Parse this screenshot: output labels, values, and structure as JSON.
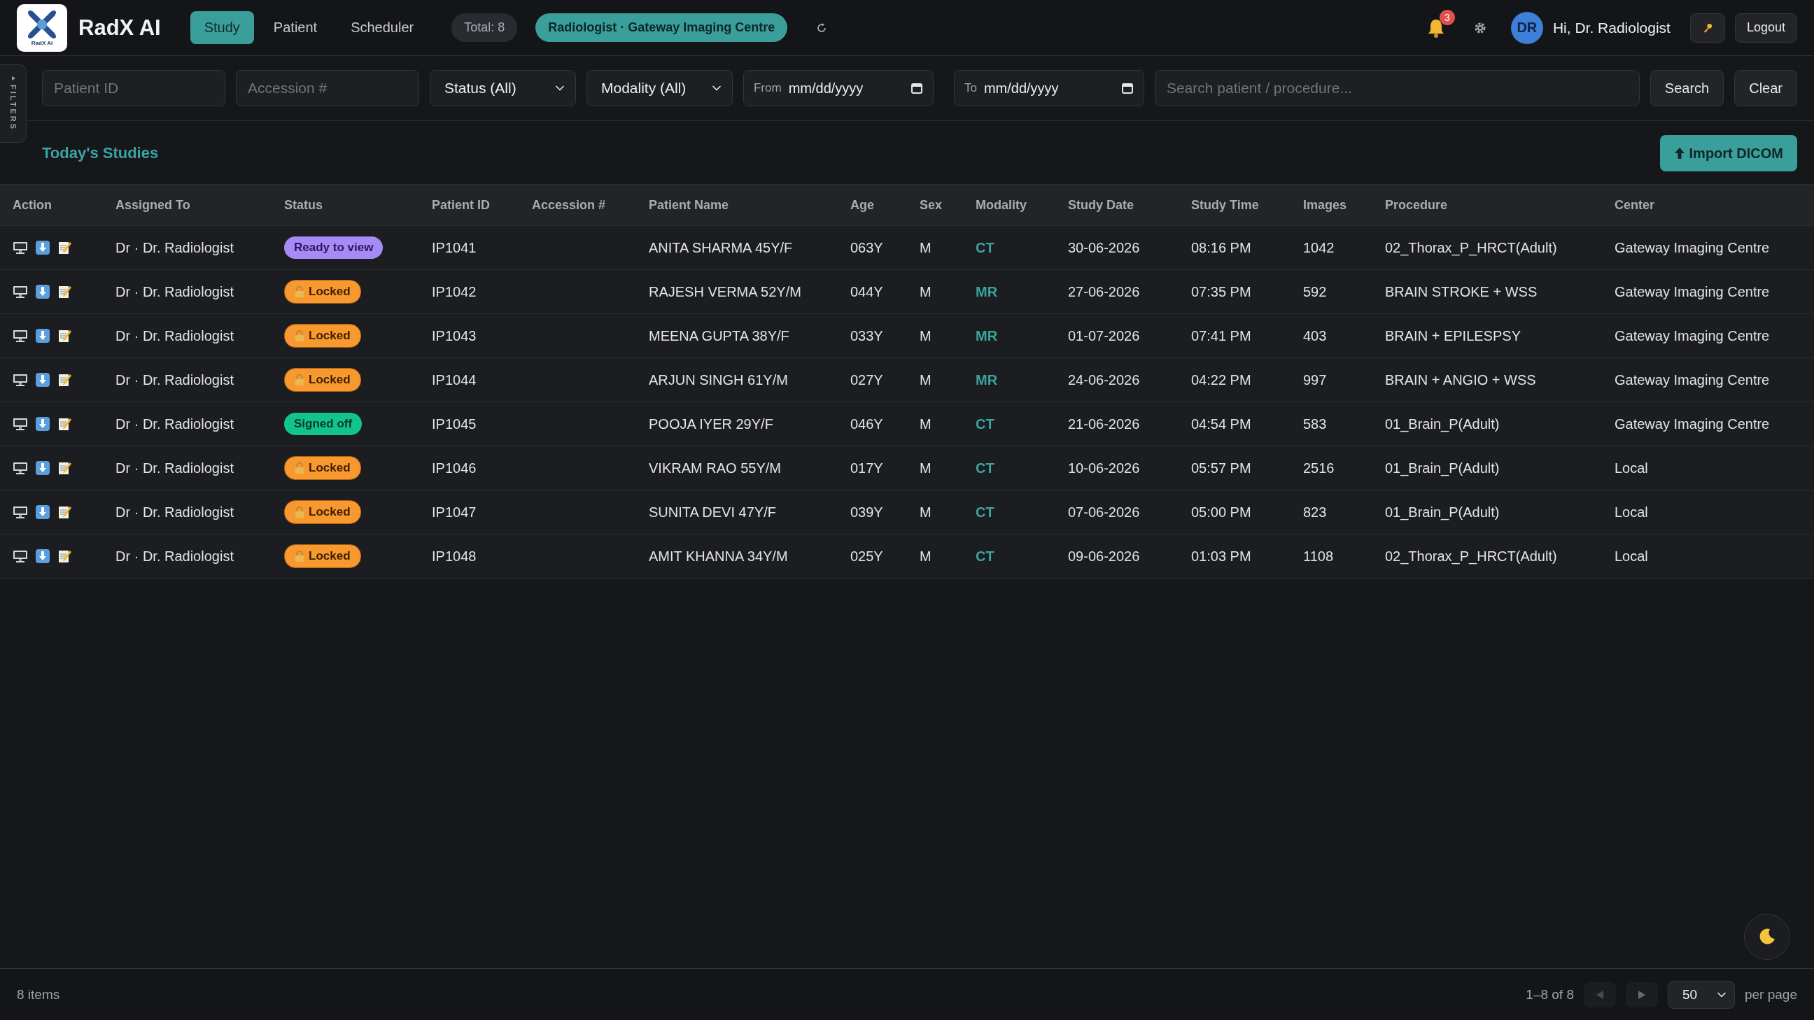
{
  "brand": {
    "logo_caption": "RadX AI",
    "name": "RadX AI"
  },
  "nav_tabs": [
    {
      "label": "Study",
      "selected": true
    },
    {
      "label": "Patient",
      "selected": false
    },
    {
      "label": "Scheduler",
      "selected": false
    }
  ],
  "total": "Total: 8",
  "role": "Radiologist · Gateway Imaging Centre",
  "notifications": "3",
  "avatar": "DR",
  "greeting": "Hi, Dr. Radiologist",
  "logout": "Logout",
  "filters_tab": "FILTERS",
  "filters": {
    "patient_id": {
      "placeholder": "Patient ID"
    },
    "accession": {
      "placeholder": "Accession #"
    },
    "status": "Status (All)",
    "modality": "Modality (All)",
    "from": {
      "label": "From",
      "value": "mm/dd/yyyy"
    },
    "to": {
      "label": "To",
      "value": "mm/dd/yyyy"
    },
    "search": {
      "placeholder": "Search patient / procedure..."
    },
    "buttons": [
      "Search",
      "Clear"
    ]
  },
  "section_title": "Today's Studies",
  "import_button": "Import DICOM",
  "table": {
    "columns": [
      "Action",
      "Assigned To",
      "Status",
      "Patient ID",
      "Accession #",
      "Patient Name",
      "Age",
      "Sex",
      "Modality",
      "Study Date",
      "Study Time",
      "Images",
      "Procedure",
      "Center"
    ],
    "rows": [
      {
        "assigned": "Dr · Dr. Radiologist",
        "status": {
          "label": "Ready to view",
          "kind": "ready"
        },
        "patient_id": "IP1041",
        "name": "ANITA SHARMA 45Y/F",
        "age": "063Y",
        "sex": "M",
        "modality": "CT",
        "date": "30-06-2026",
        "time": "08:16 PM",
        "images": "1042",
        "procedure": "02_Thorax_P_HRCT(Adult)",
        "center": "Gateway Imaging Centre"
      },
      {
        "assigned": "Dr · Dr. Radiologist",
        "status": {
          "label": "Locked",
          "kind": "locked"
        },
        "patient_id": "IP1042",
        "name": "RAJESH VERMA 52Y/M",
        "age": "044Y",
        "sex": "M",
        "modality": "MR",
        "date": "27-06-2026",
        "time": "07:35 PM",
        "images": "592",
        "procedure": "BRAIN STROKE + WSS",
        "center": "Gateway Imaging Centre"
      },
      {
        "assigned": "Dr · Dr. Radiologist",
        "status": {
          "label": "Locked",
          "kind": "locked"
        },
        "patient_id": "IP1043",
        "name": "MEENA GUPTA 38Y/F",
        "age": "033Y",
        "sex": "M",
        "modality": "MR",
        "date": "01-07-2026",
        "time": "07:41 PM",
        "images": "403",
        "procedure": "BRAIN + EPILESPSY",
        "center": "Gateway Imaging Centre"
      },
      {
        "assigned": "Dr · Dr. Radiologist",
        "status": {
          "label": "Locked",
          "kind": "locked"
        },
        "patient_id": "IP1044",
        "name": "ARJUN SINGH 61Y/M",
        "age": "027Y",
        "sex": "M",
        "modality": "MR",
        "date": "24-06-2026",
        "time": "04:22 PM",
        "images": "997",
        "procedure": "BRAIN + ANGIO + WSS",
        "center": "Gateway Imaging Centre"
      },
      {
        "assigned": "Dr · Dr. Radiologist",
        "status": {
          "label": "Signed off",
          "kind": "signed"
        },
        "patient_id": "IP1045",
        "name": "POOJA IYER 29Y/F",
        "age": "046Y",
        "sex": "M",
        "modality": "CT",
        "date": "21-06-2026",
        "time": "04:54 PM",
        "images": "583",
        "procedure": "01_Brain_P(Adult)",
        "center": "Gateway Imaging Centre"
      },
      {
        "assigned": "Dr · Dr. Radiologist",
        "status": {
          "label": "Locked",
          "kind": "locked"
        },
        "patient_id": "IP1046",
        "name": "VIKRAM RAO 55Y/M",
        "age": "017Y",
        "sex": "M",
        "modality": "CT",
        "date": "10-06-2026",
        "time": "05:57 PM",
        "images": "2516",
        "procedure": "01_Brain_P(Adult)",
        "center": "Local"
      },
      {
        "assigned": "Dr · Dr. Radiologist",
        "status": {
          "label": "Locked",
          "kind": "locked"
        },
        "patient_id": "IP1047",
        "name": "SUNITA DEVI 47Y/F",
        "age": "039Y",
        "sex": "M",
        "modality": "CT",
        "date": "07-06-2026",
        "time": "05:00 PM",
        "images": "823",
        "procedure": "01_Brain_P(Adult)",
        "center": "Local"
      },
      {
        "assigned": "Dr · Dr. Radiologist",
        "status": {
          "label": "Locked",
          "kind": "locked"
        },
        "patient_id": "IP1048",
        "name": "AMIT KHANNA 34Y/M",
        "age": "025Y",
        "sex": "M",
        "modality": "CT",
        "date": "09-06-2026",
        "time": "01:03 PM",
        "images": "1108",
        "procedure": "02_Thorax_P_HRCT(Adult)",
        "center": "Local"
      }
    ]
  },
  "footer": {
    "count": "8 items",
    "range": "1–8 of 8",
    "per_page_value": "50",
    "per_page_label": "per page"
  }
}
